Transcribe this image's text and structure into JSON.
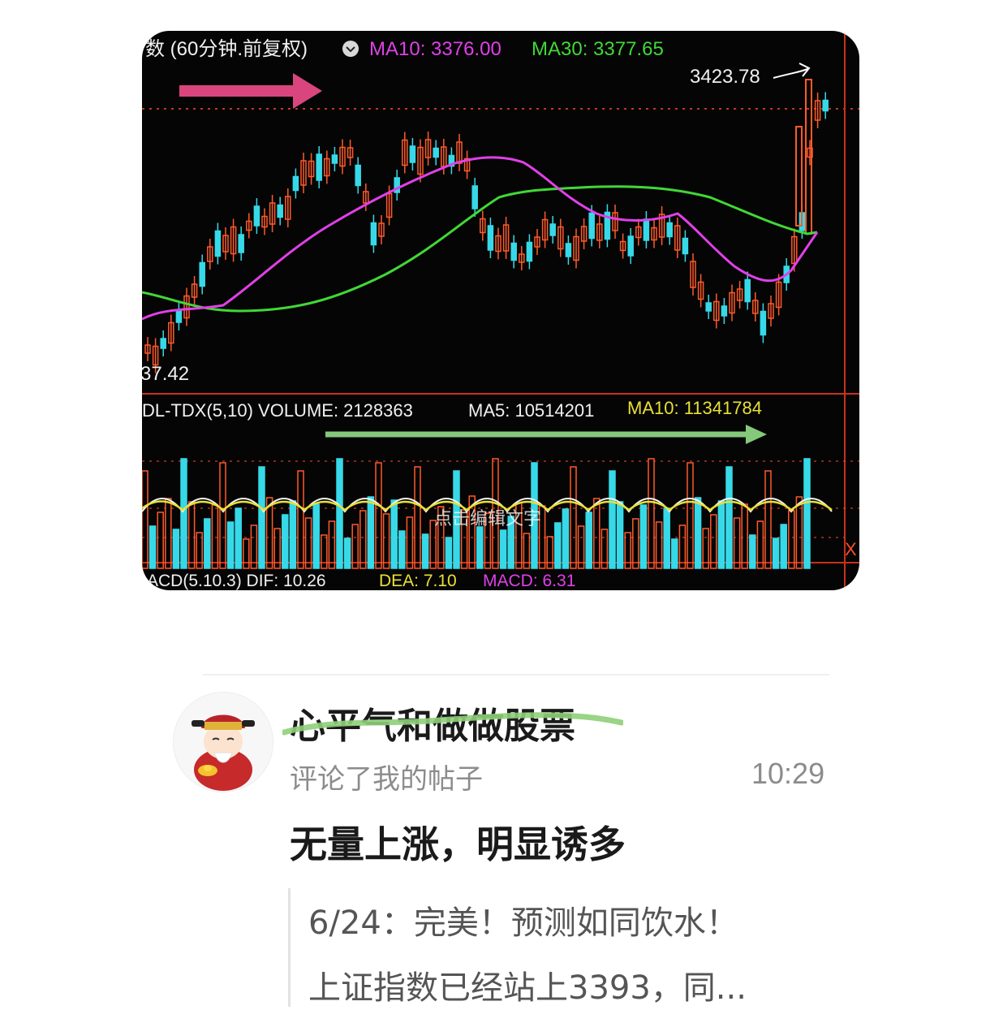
{
  "chart": {
    "header": {
      "period_label": "数 (60分钟.前复权)",
      "ma10_label": "MA10: 3376.00",
      "ma30_label": "MA30: 3377.65"
    },
    "high_label": "3423.78",
    "low_label": "37.42",
    "volume_header": {
      "indicator_label": "DL-TDX(5,10) VOLUME: 2128363",
      "ma5_label": "MA5: 10514201",
      "ma10_label": "MA10: 11341784"
    },
    "overlay_text": "点击编辑文字",
    "macd_header": {
      "name_label": "ACD(5.10.3) DIF: 10.26",
      "dea_label": "DEA: 7.10",
      "macd_label": "MACD: 6.31"
    },
    "corner_mark": "X",
    "colors": {
      "up": "#ff5a2a",
      "down": "#37d9e8",
      "ma10": "#e040e8",
      "ma30": "#41d836",
      "arrow_top": "#d9467e",
      "arrow_volume": "#84c97a",
      "yellow": "#e8e035"
    }
  },
  "post": {
    "avatar_icon": "caishen-avatar-icon",
    "username": "心平气和做做股票",
    "action_text": "评论了我的帖子",
    "time": "10:29",
    "comment": "无量上涨，明显诱多",
    "quote_line1": "6/24：完美！预测如同饮水！",
    "quote_line2": "上证指数已经站上3393，同..."
  }
}
